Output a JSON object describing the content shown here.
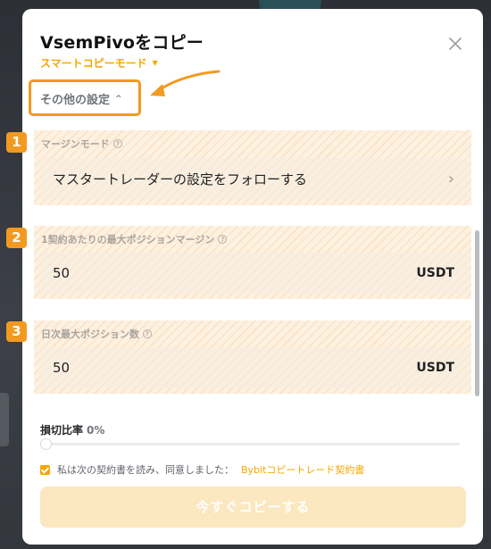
{
  "dialog": {
    "title": "VsemPivoをコピー",
    "copy_mode": "スマートコピーモード",
    "other_settings": "その他の設定"
  },
  "annotations": {
    "badges": [
      "1",
      "2",
      "3"
    ],
    "highlight_color": "#f29a1f"
  },
  "margin_mode": {
    "label": "マージンモード",
    "value": "マスタートレーダーの設定をフォローする"
  },
  "max_position_margin": {
    "label": "1契約あたりの最大ポジションマージン",
    "value": "50",
    "unit": "USDT"
  },
  "daily_max_position": {
    "label": "日次最大ポジション数",
    "value": "50",
    "unit": "USDT"
  },
  "stop_loss": {
    "label": "損切比率",
    "value": "0%",
    "slider_fraction": 0
  },
  "agreement": {
    "text": "私は次の契約書を読み、同意しました：",
    "link": "Bybitコピートレード契約書",
    "checked": true
  },
  "copy_button": {
    "label": "今すぐコピーする"
  },
  "colors": {
    "accent": "#f7a600",
    "button_disabled": "#fbe7c0"
  }
}
